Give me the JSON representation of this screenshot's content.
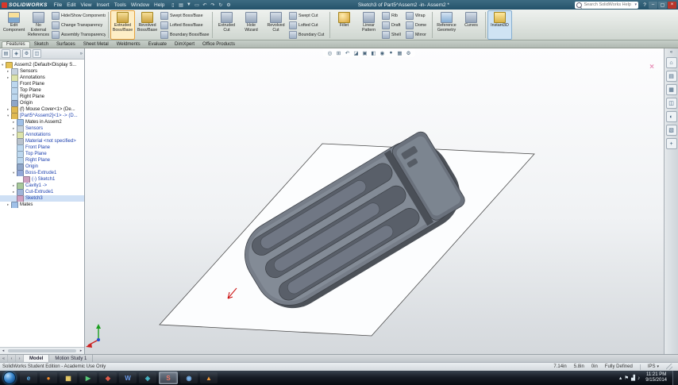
{
  "colors": {
    "titlebar_bg": "#2f5f77",
    "highlight_orange": "#e8a33d",
    "active_blue": "#86aed0",
    "edited_tree_text": "#1b3fae",
    "logo_red": "#d8372a"
  },
  "titlebar": {
    "logo_text": "SOLIDWORKS",
    "menus": [
      {
        "label": "File",
        "name": "menu-file"
      },
      {
        "label": "Edit",
        "name": "menu-edit"
      },
      {
        "label": "View",
        "name": "menu-view"
      },
      {
        "label": "Insert",
        "name": "menu-insert"
      },
      {
        "label": "Tools",
        "name": "menu-tools"
      },
      {
        "label": "Window",
        "name": "menu-window"
      },
      {
        "label": "Help",
        "name": "menu-help"
      }
    ],
    "quick_icons": [
      {
        "name": "new-icon",
        "glyph": "▯"
      },
      {
        "name": "open-icon",
        "glyph": "▤"
      },
      {
        "name": "save-icon",
        "glyph": "▼"
      },
      {
        "name": "print-icon",
        "glyph": "▭"
      },
      {
        "name": "undo-icon",
        "glyph": "↶"
      },
      {
        "name": "redo-icon",
        "glyph": "↷"
      },
      {
        "name": "rebuild-icon",
        "glyph": "↻"
      },
      {
        "name": "options-icon",
        "glyph": "⚙"
      }
    ],
    "doc_title": "Sketch3 of Part5^Assem2 -in- Assem2 *",
    "search_placeholder": "Search SolidWorks Help",
    "search_arrow": "▾",
    "help_glyph": "?",
    "window_controls": [
      {
        "name": "minimize-button",
        "glyph": "–"
      },
      {
        "name": "maximize-button",
        "glyph": "▢"
      },
      {
        "name": "close-button",
        "glyph": "×",
        "state": "close"
      }
    ]
  },
  "ribbon": {
    "tabs": [
      {
        "label": "Features",
        "name": "tab-features",
        "state": "active"
      },
      {
        "label": "Sketch",
        "name": "tab-sketch"
      },
      {
        "label": "Surfaces",
        "name": "tab-surfaces"
      },
      {
        "label": "Sheet Metal",
        "name": "tab-sheet-metal"
      },
      {
        "label": "Weldments",
        "name": "tab-weldments"
      },
      {
        "label": "Evaluate",
        "name": "tab-evaluate"
      },
      {
        "label": "DimXpert",
        "name": "tab-dimxpert"
      },
      {
        "label": "Office Products",
        "name": "tab-office-products"
      }
    ],
    "assembly": {
      "big": [
        {
          "label": "Edit Component",
          "name": "edit-component-button",
          "icon": "edit-component-icon"
        },
        {
          "label": "No External References",
          "name": "no-external-references-button",
          "icon": "no-external-references-icon"
        }
      ],
      "stack": [
        {
          "label": "Hide/Show Components",
          "name": "hide-show-components-button",
          "icon": "hide-show-components-icon"
        },
        {
          "label": "Change Transparency",
          "name": "change-transparency-button",
          "icon": "change-transparency-icon"
        },
        {
          "label": "Assembly Transparency",
          "name": "assembly-transparency-button",
          "icon": "assembly-transparency-icon"
        }
      ]
    },
    "boss": {
      "big": [
        {
          "label": "Extruded Boss/Base",
          "name": "extruded-boss-base-button",
          "icon": "extruded-boss-base-icon",
          "state": "highlight"
        },
        {
          "label": "Revolved Boss/Base",
          "name": "revolved-boss-base-button",
          "icon": "revolved-boss-base-icon"
        }
      ],
      "stack": [
        {
          "label": "Swept Boss/Base",
          "name": "swept-boss-base-button",
          "icon": "swept-boss-base-icon"
        },
        {
          "label": "Lofted Boss/Base",
          "name": "lofted-boss-base-button",
          "icon": "lofted-boss-base-icon"
        },
        {
          "label": "Boundary Boss/Base",
          "name": "boundary-boss-base-button",
          "icon": "boundary-boss-base-icon"
        }
      ]
    },
    "cut": {
      "big": [
        {
          "label": "Extruded Cut",
          "name": "extruded-cut-button",
          "icon": "extruded-cut-icon"
        },
        {
          "label": "Hole Wizard",
          "name": "hole-wizard-button",
          "icon": "hole-wizard-icon"
        },
        {
          "label": "Revolved Cut",
          "name": "revolved-cut-button",
          "icon": "revolved-cut-icon"
        }
      ],
      "stack": [
        {
          "label": "Swept Cut",
          "name": "swept-cut-button",
          "icon": "swept-cut-icon"
        },
        {
          "label": "Lofted Cut",
          "name": "lofted-cut-button",
          "icon": "lofted-cut-icon"
        },
        {
          "label": "Boundary Cut",
          "name": "boundary-cut-button",
          "icon": "boundary-cut-icon"
        }
      ]
    },
    "pattern": {
      "big": [
        {
          "label": "Fillet",
          "name": "fillet-button",
          "icon": "fillet-icon"
        },
        {
          "label": "Linear Pattern",
          "name": "linear-pattern-button",
          "icon": "linear-pattern-icon"
        }
      ],
      "stack1": [
        {
          "label": "Rib",
          "name": "rib-button",
          "icon": "rib-icon"
        },
        {
          "label": "Draft",
          "name": "draft-button",
          "icon": "draft-icon"
        },
        {
          "label": "Shell",
          "name": "shell-button",
          "icon": "shell-icon"
        }
      ],
      "stack2": [
        {
          "label": "Wrap",
          "name": "wrap-button",
          "icon": "wrap-icon"
        },
        {
          "label": "Dome",
          "name": "dome-button",
          "icon": "dome-icon"
        },
        {
          "label": "Mirror",
          "name": "mirror-button",
          "icon": "mirror-icon"
        }
      ]
    },
    "reference": {
      "big": [
        {
          "label": "Reference Geometry",
          "name": "reference-geometry-button",
          "icon": "reference-geometry-icon"
        },
        {
          "label": "Curves",
          "name": "curves-button",
          "icon": "curves-icon"
        }
      ]
    },
    "instant": {
      "big": [
        {
          "label": "Instant3D",
          "name": "instant3d-button",
          "icon": "instant3d-icon",
          "state": "active"
        }
      ]
    }
  },
  "tree": {
    "header_icons": [
      {
        "name": "featuremanager-tab-icon",
        "glyph": "▤"
      },
      {
        "name": "propertymanager-tab-icon",
        "glyph": "◈"
      },
      {
        "name": "configurationmanager-tab-icon",
        "glyph": "⚙"
      },
      {
        "name": "displaymanager-tab-icon",
        "glyph": "◫"
      }
    ],
    "header_chevron": "»",
    "scroll_left": "◂",
    "scroll_right": "▸",
    "items": [
      {
        "label": "Assem2 (Default<Display S...",
        "depth": "0",
        "arrow": "▾",
        "icon": "assembly-icon",
        "name": "tree-item-assem2"
      },
      {
        "label": "Sensors",
        "depth": "1",
        "arrow": "▸",
        "icon": "sensors-icon",
        "name": "tree-item-sensors"
      },
      {
        "label": "Annotations",
        "depth": "1",
        "arrow": "▸",
        "icon": "annotations-icon",
        "name": "tree-item-annotations"
      },
      {
        "label": "Front Plane",
        "depth": "1",
        "arrow": "",
        "icon": "plane-icon",
        "name": "tree-item-front-plane"
      },
      {
        "label": "Top Plane",
        "depth": "1",
        "arrow": "",
        "icon": "plane-icon",
        "name": "tree-item-top-plane"
      },
      {
        "label": "Right Plane",
        "depth": "1",
        "arrow": "",
        "icon": "plane-icon",
        "name": "tree-item-right-plane"
      },
      {
        "label": "Origin",
        "depth": "1",
        "arrow": "",
        "icon": "origin-icon",
        "name": "tree-item-origin"
      },
      {
        "label": "(f) Mouse Cover<1> (De...",
        "depth": "1",
        "arrow": "▸",
        "icon": "part-icon",
        "name": "tree-item-mouse-cover"
      },
      {
        "label": "[Part5^Assem2]<1> -> (D...",
        "depth": "1",
        "arrow": "▾",
        "icon": "part-icon",
        "emph": "edited",
        "name": "tree-item-part5-assem2"
      },
      {
        "label": "Mates in Assem2",
        "depth": "2",
        "arrow": "▸",
        "icon": "mates-icon",
        "name": "tree-item-mates-in-assem2"
      },
      {
        "label": "Sensors",
        "depth": "2",
        "arrow": "▸",
        "icon": "sensors-icon",
        "emph": "edited",
        "name": "tree-item-sensors-2"
      },
      {
        "label": "Annotations",
        "depth": "2",
        "arrow": "▸",
        "icon": "annotations-icon",
        "emph": "edited",
        "name": "tree-item-annotations-2"
      },
      {
        "label": "Material <not specified>",
        "depth": "2",
        "arrow": "",
        "icon": "material-icon",
        "emph": "edited",
        "name": "tree-item-material"
      },
      {
        "label": "Front Plane",
        "depth": "2",
        "arrow": "",
        "icon": "plane-icon",
        "emph": "edited",
        "name": "tree-item-front-plane-2"
      },
      {
        "label": "Top Plane",
        "depth": "2",
        "arrow": "",
        "icon": "plane-icon",
        "emph": "edited",
        "name": "tree-item-top-plane-2"
      },
      {
        "label": "Right Plane",
        "depth": "2",
        "arrow": "",
        "icon": "plane-icon",
        "emph": "edited",
        "name": "tree-item-right-plane-2"
      },
      {
        "label": "Origin",
        "depth": "2",
        "arrow": "",
        "icon": "origin-icon",
        "emph": "edited",
        "name": "tree-item-origin-2"
      },
      {
        "label": "Boss-Extrude1",
        "depth": "2",
        "arrow": "▾",
        "icon": "boss-extrude-icon",
        "emph": "edited",
        "name": "tree-item-boss-extrude1"
      },
      {
        "label": "(-) Sketch1",
        "depth": "3",
        "arrow": "",
        "icon": "sketch-icon",
        "emph": "edited",
        "name": "tree-item-sketch1"
      },
      {
        "label": "Cavity1 ->",
        "depth": "2",
        "arrow": "▸",
        "icon": "cavity-icon",
        "emph": "edited",
        "name": "tree-item-cavity1"
      },
      {
        "label": "Cut-Extrude1",
        "depth": "2",
        "arrow": "▸",
        "icon": "cut-extrude-icon",
        "emph": "edited",
        "name": "tree-item-cut-extrude1"
      },
      {
        "label": "Sketch3",
        "depth": "2",
        "arrow": "",
        "icon": "sketch-icon",
        "emph": "edited",
        "state": "selected",
        "name": "tree-item-sketch3"
      },
      {
        "label": "Mates",
        "depth": "1",
        "arrow": "▸",
        "icon": "mates-icon",
        "name": "tree-item-mates"
      }
    ]
  },
  "headsup": [
    {
      "name": "zoom-to-fit-icon",
      "glyph": "◎"
    },
    {
      "name": "zoom-to-area-icon",
      "glyph": "⊞"
    },
    {
      "name": "previous-view-icon",
      "glyph": "↶"
    },
    {
      "name": "section-view-icon",
      "glyph": "◪"
    },
    {
      "name": "view-orientation-icon",
      "glyph": "▣"
    },
    {
      "name": "display-style-icon",
      "glyph": "◧"
    },
    {
      "name": "hide-show-items-icon",
      "glyph": "◉"
    },
    {
      "name": "edit-appearance-icon",
      "glyph": "●"
    },
    {
      "name": "apply-scene-icon",
      "glyph": "▦"
    },
    {
      "name": "view-settings-icon",
      "glyph": "⚙"
    }
  ],
  "viewport": {
    "cancel_glyph": "×"
  },
  "taskpane_chevron": "«",
  "taskpane": [
    {
      "name": "solidworks-resources-icon",
      "glyph": "⌂"
    },
    {
      "name": "design-library-icon",
      "glyph": "▤"
    },
    {
      "name": "file-explorer-icon",
      "glyph": "▦"
    },
    {
      "name": "view-palette-icon",
      "glyph": "◫"
    },
    {
      "name": "appearances-icon",
      "glyph": "◐"
    },
    {
      "name": "custom-properties-icon",
      "glyph": "▧"
    },
    {
      "name": "document-recovery-icon",
      "glyph": "+"
    }
  ],
  "modeltabs": {
    "nav": [
      {
        "name": "model-tabs-first-icon",
        "glyph": "«"
      },
      {
        "name": "model-tabs-prev-icon",
        "glyph": "‹"
      },
      {
        "name": "model-tabs-next-icon",
        "glyph": "›"
      }
    ],
    "tabs": [
      {
        "label": "Model",
        "name": "tab-model",
        "state": "active"
      },
      {
        "label": "Motion Study 1",
        "name": "tab-motion-study-1"
      }
    ]
  },
  "statusbar": {
    "left": "SolidWorks Student Edition - Academic Use Only",
    "x": "7.14in",
    "y": "5.8in",
    "z": "0in",
    "state": "Fully Defined",
    "units": "IPS",
    "units_arrow": "▾"
  },
  "taskbar": {
    "clock_time": "11:21 PM",
    "clock_date": "9/15/2014",
    "apps": [
      {
        "name": "taskbar-internet-explorer-icon",
        "glyph": "e",
        "style": "color:#5ab0f0"
      },
      {
        "name": "taskbar-firefox-icon",
        "glyph": "●",
        "style": "color:#f08a2a"
      },
      {
        "name": "taskbar-explorer-icon",
        "glyph": "▦",
        "style": "color:#f0d26a"
      },
      {
        "name": "taskbar-media-player-icon",
        "glyph": "▶",
        "style": "color:#58c878"
      },
      {
        "name": "taskbar-app-red-icon",
        "glyph": "◆",
        "style": "color:#e05a4a"
      },
      {
        "name": "taskbar-word-icon",
        "glyph": "W",
        "style": "color:#6a9ae8"
      },
      {
        "name": "taskbar-app-teal-icon",
        "glyph": "◈",
        "style": "color:#48b8c8"
      },
      {
        "name": "taskbar-solidworks-icon",
        "glyph": "S",
        "style": "color:#f07868",
        "state": "active"
      },
      {
        "name": "taskbar-app-blue-icon",
        "glyph": "◉",
        "style": "color:#78b0e8"
      },
      {
        "name": "taskbar-vlc-icon",
        "glyph": "▲",
        "style": "color:#f09a3a"
      }
    ],
    "tray": [
      {
        "name": "show-hidden-icons-icon",
        "glyph": "▴"
      },
      {
        "name": "tray-flag-icon",
        "glyph": "⚑"
      },
      {
        "name": "tray-network-icon",
        "glyph": "▟"
      },
      {
        "name": "tray-volume-icon",
        "glyph": "♪"
      }
    ]
  }
}
